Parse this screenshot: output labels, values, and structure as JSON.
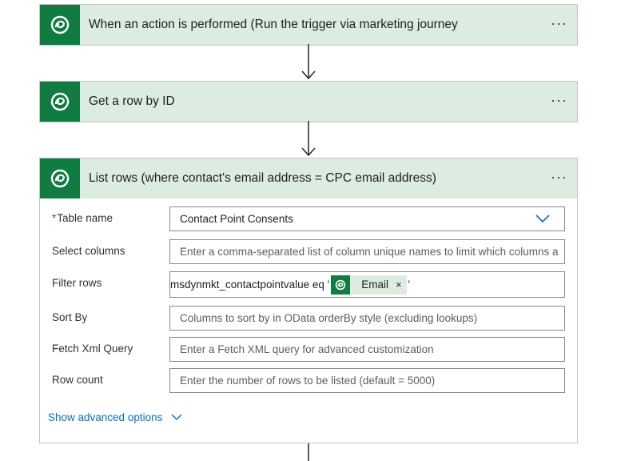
{
  "steps": [
    {
      "title": "When an action is performed (Run the trigger via marketing journey"
    },
    {
      "title": "Get a row by ID"
    },
    {
      "title": "List rows (where contact's email address = CPC email address)"
    }
  ],
  "more_label": "···",
  "list_rows": {
    "required_marker": "*",
    "fields": {
      "table_name": {
        "label": "Table name",
        "value": "Contact Point Consents"
      },
      "select_columns": {
        "label": "Select columns",
        "placeholder": "Enter a comma-separated list of column unique names to limit which columns a"
      },
      "filter_rows": {
        "label": "Filter rows",
        "prefix": "msdynmkt_contactpointvalue eq '",
        "token": "Email",
        "token_close": "×",
        "suffix": "'"
      },
      "sort_by": {
        "label": "Sort By",
        "placeholder": "Columns to sort by in OData orderBy style (excluding lookups)"
      },
      "fetch_xml": {
        "label": "Fetch Xml Query",
        "placeholder": "Enter a Fetch XML query for advanced customization"
      },
      "row_count": {
        "label": "Row count",
        "placeholder": "Enter the number of rows to be listed (default = 5000)"
      }
    },
    "advanced_label": "Show advanced options"
  },
  "icons": [
    "dataverse-logo-icon",
    "more-options-icon",
    "chevron-down-icon",
    "arrow-down-icon",
    "close-icon"
  ],
  "colors": {
    "accent": "#107c41",
    "header_bg": "#dcece3",
    "link": "#0f6cbd",
    "required": "#a4262c"
  }
}
